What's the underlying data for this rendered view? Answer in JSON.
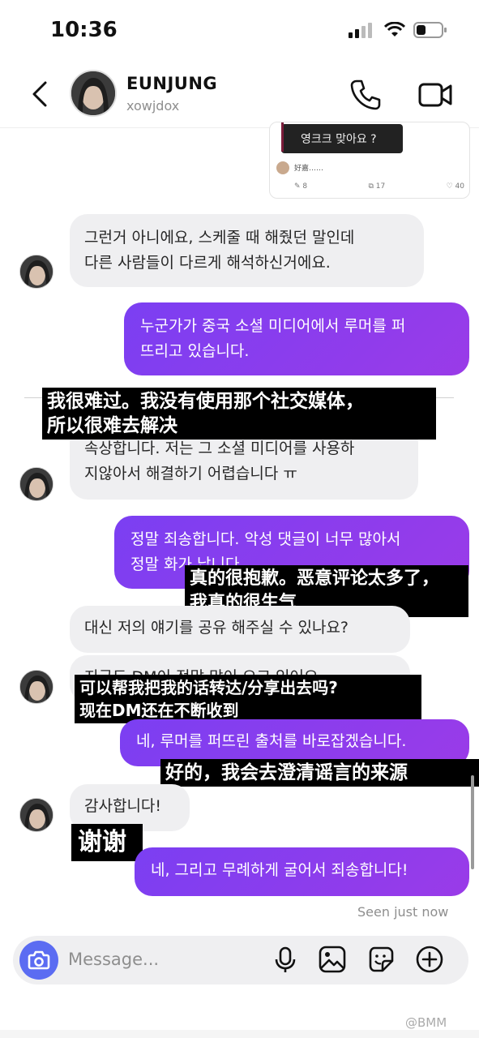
{
  "status": {
    "time": "10:36"
  },
  "header": {
    "name": "EUNJUNG",
    "handle": "xowjdox"
  },
  "shared_post": {
    "text": "영크크 맞아요 ?",
    "comment": "好嘉……",
    "stats": [
      "8",
      "17",
      "40"
    ]
  },
  "messages": [
    {
      "dir": "in",
      "text": "그런거 아니에요, 스케줄 때 해줬던 말인데\n다른 사람들이 다르게 해석하신거에요."
    },
    {
      "dir": "out",
      "text": "누군가가 중국 소셜 미디어에서 루머를 퍼\n뜨리고 있습니다."
    },
    {
      "dir": "in",
      "text": "속상합니다. 저는 그 소셜 미디어를 사용하\n지않아서 해결하기 어렵습니다 ㅠ"
    },
    {
      "dir": "out",
      "text": "정말 죄송합니다. 악성 댓글이 너무 많아서\n정말 화가 납니다."
    },
    {
      "dir": "in",
      "text": "대신 저의 얘기를 공유 해주실 수 있나요?"
    },
    {
      "dir": "in",
      "text": "지금도 DM이 정말 많이 오고 있어요"
    },
    {
      "dir": "out",
      "text": "네, 루머를 퍼뜨린 출처를 바로잡겠습니다."
    },
    {
      "dir": "in",
      "text": "감사합니다!"
    },
    {
      "dir": "out",
      "text": "네, 그리고 무례하게 굴어서 죄송합니다!"
    }
  ],
  "subtitles": [
    "我很难过。我没有使用那个社交媒体，\n所以很难去解决",
    "真的很抱歉。恶意评论太多了，\n我真的很生气",
    "可以帮我把我的话转达/分享出去吗?\n现在DM还在不断收到",
    "好的，我会去澄清谣言的来源",
    "谢谢"
  ],
  "seen": "Seen just now",
  "composer": {
    "placeholder": "Message..."
  },
  "watermark": "@BMM",
  "colors": {
    "outgoing": "#8a3ff0",
    "incoming": "#efeff1",
    "camera": "#5b6cf2"
  },
  "icons": [
    "back-icon",
    "phone-icon",
    "video-icon",
    "camera-icon",
    "microphone-icon",
    "gallery-icon",
    "sticker-icon",
    "plus-icon"
  ]
}
